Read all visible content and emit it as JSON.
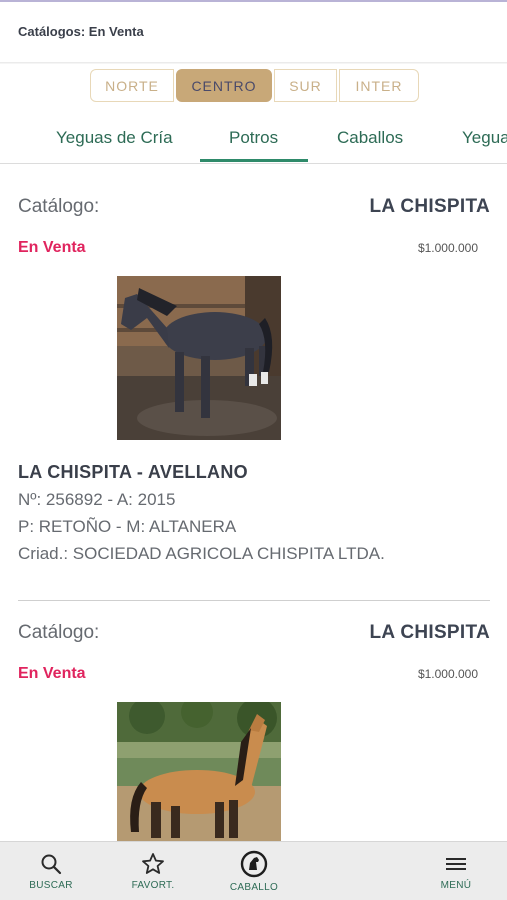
{
  "header": {
    "title": "Catálogos: En Venta"
  },
  "regions": [
    {
      "label": "NORTE",
      "active": false
    },
    {
      "label": "CENTRO",
      "active": true
    },
    {
      "label": "SUR",
      "active": false
    },
    {
      "label": "INTER",
      "active": false
    }
  ],
  "tabs": [
    {
      "label": "Yeguas de Cría",
      "active": false
    },
    {
      "label": "Potros",
      "active": true
    },
    {
      "label": "Caballos",
      "active": false
    },
    {
      "label": "Yegua",
      "active": false
    }
  ],
  "listings": [
    {
      "catalog_label": "Catálogo:",
      "catalog_value": "LA CHISPITA",
      "status": "En Venta",
      "price": "$1.000.000",
      "name": "LA CHISPITA - AVELLANO",
      "number_line": "Nº: 256892 - A: 2015",
      "parents_line": "P: RETOÑO - M: ALTANERA",
      "breeder_line": "Criad.: SOCIEDAD AGRICOLA CHISPITA LTDA."
    },
    {
      "catalog_label": "Catálogo:",
      "catalog_value": "LA CHISPITA",
      "status": "En Venta",
      "price": "$1.000.000"
    }
  ],
  "bottom_nav": [
    {
      "label": "BUSCAR",
      "icon": "search-icon"
    },
    {
      "label": "FAVORT.",
      "icon": "star-icon"
    },
    {
      "label": "CABALLO",
      "icon": "horse-icon"
    },
    {
      "label": "MENÚ",
      "icon": "menu-icon"
    }
  ],
  "colors": {
    "accent_green": "#2d6b55",
    "region_active": "#c8a878",
    "status_pink": "#e0245e"
  }
}
